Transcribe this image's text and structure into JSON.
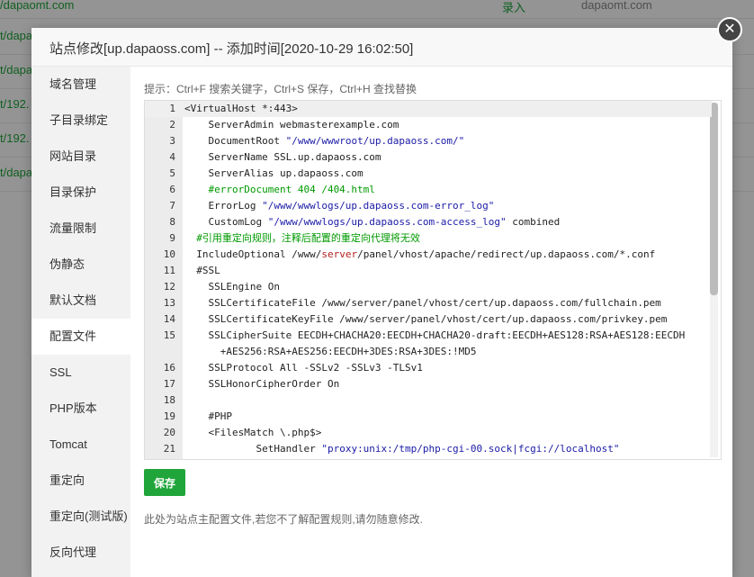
{
  "background": {
    "rows": [
      {
        "site": "/dapaomt.com",
        "col2": "录入",
        "col3": "dapaomt.com"
      },
      {
        "site": "t/dapa",
        "col2": "",
        "col3": ""
      },
      {
        "site": "t/dapa",
        "col2": "",
        "col3": ""
      },
      {
        "site": "t/192.",
        "col2": "",
        "col3": ""
      },
      {
        "site": "t/192.",
        "col2": "",
        "col3": ""
      },
      {
        "site": "t/dapa",
        "col2": "",
        "col3": ""
      }
    ]
  },
  "modal": {
    "title": "站点修改[up.dapaoss.com] -- 添加时间[2020-10-29 16:02:50]",
    "close_glyph": "✕"
  },
  "sidebar": {
    "items": [
      {
        "label": "域名管理"
      },
      {
        "label": "子目录绑定"
      },
      {
        "label": "网站目录"
      },
      {
        "label": "目录保护"
      },
      {
        "label": "流量限制"
      },
      {
        "label": "伪静态"
      },
      {
        "label": "默认文档"
      },
      {
        "label": "配置文件"
      },
      {
        "label": "SSL"
      },
      {
        "label": "PHP版本"
      },
      {
        "label": "Tomcat"
      },
      {
        "label": "重定向"
      },
      {
        "label": "重定向(测试版)"
      },
      {
        "label": "反向代理"
      }
    ],
    "active_index": 7
  },
  "editor": {
    "hint": "提示：Ctrl+F 搜索关键字，Ctrl+S 保存，Ctrl+H 查找替换",
    "lines": [
      {
        "n": "1",
        "parts": [
          {
            "t": "<VirtualHost *:443>",
            "c": ""
          }
        ]
      },
      {
        "n": "2",
        "parts": [
          {
            "t": "    ServerAdmin webmasterexample.com",
            "c": ""
          }
        ]
      },
      {
        "n": "3",
        "parts": [
          {
            "t": "    DocumentRoot ",
            "c": ""
          },
          {
            "t": "\"/www/wwwroot/up.dapaoss.com/\"",
            "c": "b"
          }
        ]
      },
      {
        "n": "4",
        "parts": [
          {
            "t": "    ServerName SSL.up.dapaoss.com",
            "c": ""
          }
        ]
      },
      {
        "n": "5",
        "parts": [
          {
            "t": "    ServerAlias up.dapaoss.com",
            "c": ""
          }
        ]
      },
      {
        "n": "6",
        "parts": [
          {
            "t": "    #errorDocument 404 /404.html",
            "c": "g"
          }
        ]
      },
      {
        "n": "7",
        "parts": [
          {
            "t": "    ErrorLog ",
            "c": ""
          },
          {
            "t": "\"/www/wwwlogs/up.dapaoss.com-error_log\"",
            "c": "b"
          }
        ]
      },
      {
        "n": "8",
        "parts": [
          {
            "t": "    CustomLog ",
            "c": ""
          },
          {
            "t": "\"/www/wwwlogs/up.dapaoss.com-access_log\"",
            "c": "b"
          },
          {
            "t": " combined",
            "c": ""
          }
        ]
      },
      {
        "n": "9",
        "parts": [
          {
            "t": "  #引用重定向规则，注释后配置的重定向代理将无效",
            "c": "g"
          }
        ]
      },
      {
        "n": "10",
        "parts": [
          {
            "t": "  IncludeOptional /www/",
            "c": ""
          },
          {
            "t": "server",
            "c": "r"
          },
          {
            "t": "/panel/vhost/apache/redirect/up.dapaoss.com/*.conf",
            "c": ""
          }
        ]
      },
      {
        "n": "11",
        "parts": [
          {
            "t": "  #SSL",
            "c": ""
          }
        ]
      },
      {
        "n": "12",
        "parts": [
          {
            "t": "    SSLEngine On",
            "c": ""
          }
        ]
      },
      {
        "n": "13",
        "parts": [
          {
            "t": "    SSLCertificateFile /www/server/panel/vhost/cert/up.dapaoss.com/fullchain.pem",
            "c": ""
          }
        ]
      },
      {
        "n": "14",
        "parts": [
          {
            "t": "    SSLCertificateKeyFile /www/server/panel/vhost/cert/up.dapaoss.com/privkey.pem",
            "c": ""
          }
        ]
      },
      {
        "n": "15",
        "parts": [
          {
            "t": "    SSLCipherSuite EECDH+CHACHA20:EECDH+CHACHA20-draft:EECDH+AES128:RSA+AES128:EECDH",
            "c": ""
          }
        ]
      },
      {
        "n": "",
        "parts": [
          {
            "t": "      +AES256:RSA+AES256:EECDH+3DES:RSA+3DES:!MD5",
            "c": ""
          }
        ]
      },
      {
        "n": "16",
        "parts": [
          {
            "t": "    SSLProtocol All -SSLv2 -SSLv3 -TLSv1",
            "c": ""
          }
        ]
      },
      {
        "n": "17",
        "parts": [
          {
            "t": "    SSLHonorCipherOrder On",
            "c": ""
          }
        ]
      },
      {
        "n": "18",
        "parts": [
          {
            "t": "",
            "c": ""
          }
        ]
      },
      {
        "n": "19",
        "parts": [
          {
            "t": "    #PHP",
            "c": ""
          }
        ]
      },
      {
        "n": "20",
        "parts": [
          {
            "t": "    <FilesMatch \\.php$>",
            "c": ""
          }
        ]
      },
      {
        "n": "21",
        "parts": [
          {
            "t": "            SetHandler ",
            "c": ""
          },
          {
            "t": "\"proxy:unix:/tmp/php-cgi-00.sock|fcgi://localhost\"",
            "c": "b"
          }
        ]
      }
    ]
  },
  "actions": {
    "save_label": "保存",
    "note": "此处为站点主配置文件,若您不了解配置规则,请勿随意修改."
  },
  "colors": {
    "accent": "#20a53a",
    "comment": "#009a00",
    "string": "#1a1aa6",
    "keyword": "#b31d1d"
  }
}
